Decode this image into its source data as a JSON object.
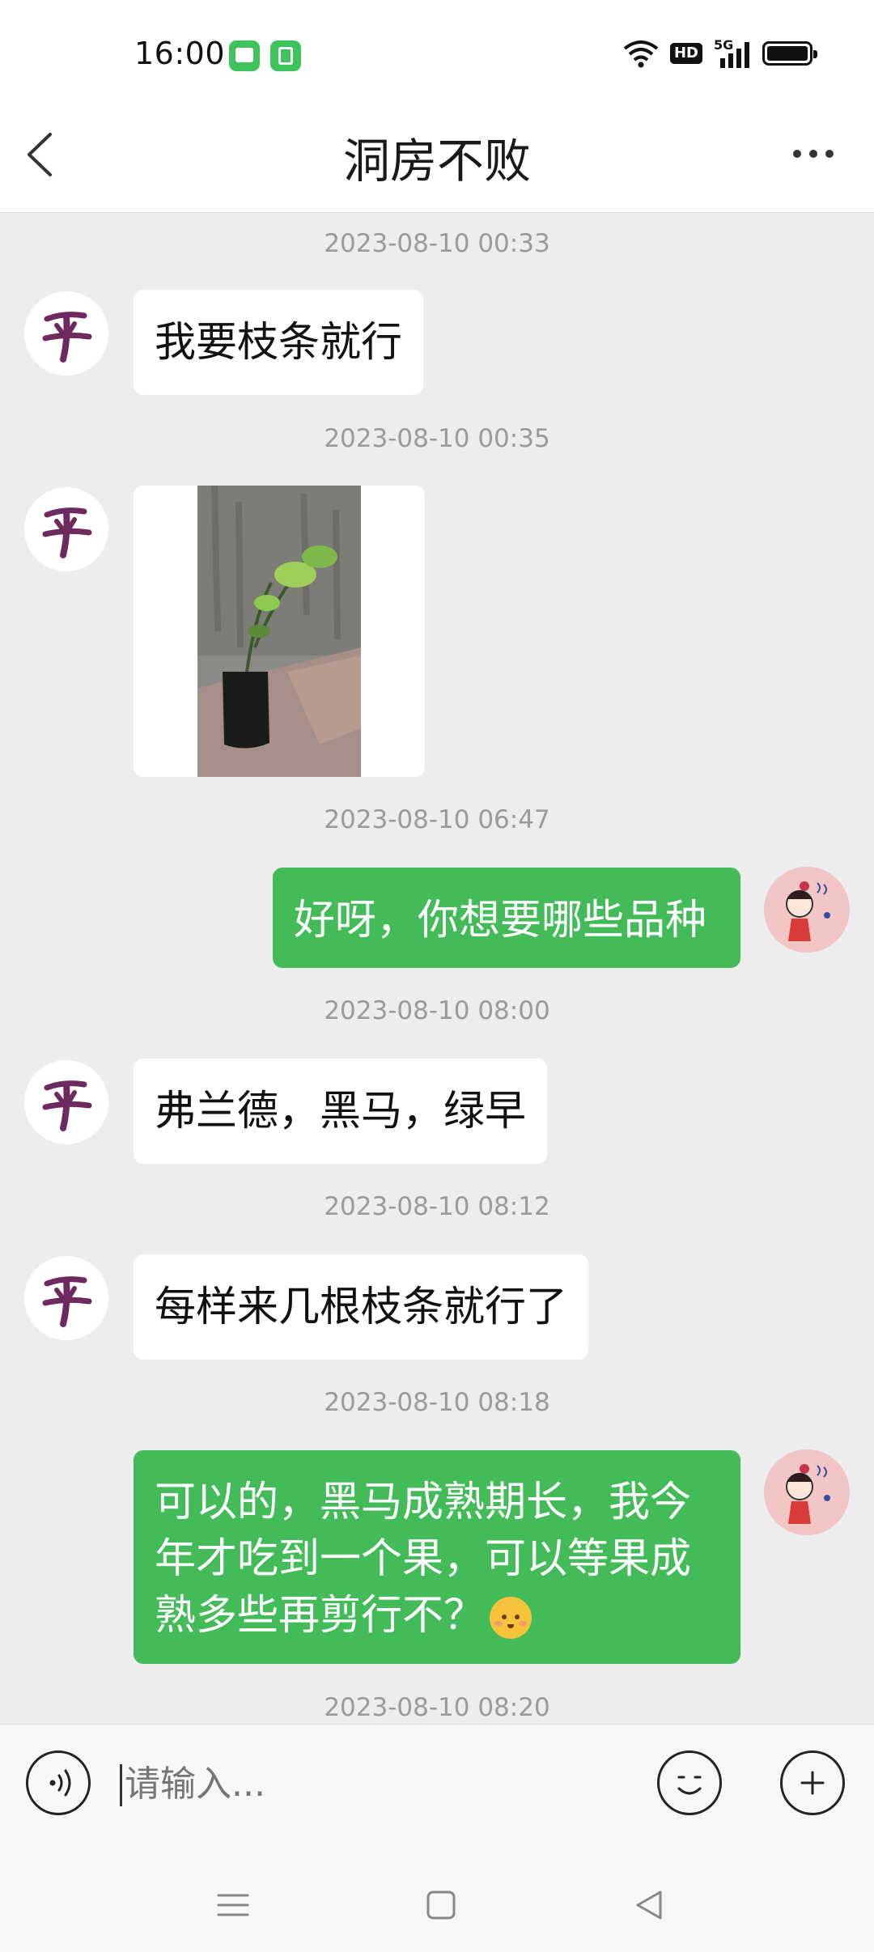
{
  "status_bar": {
    "time": "16:00",
    "notification_icons": [
      "message-app-icon",
      "store-app-icon"
    ],
    "indicators": {
      "wifi": "wifi-icon",
      "hd": "HD",
      "network": "5G",
      "battery": "battery-icon"
    }
  },
  "header": {
    "title": "洞房不败",
    "back_icon": "chevron-left-icon",
    "more_icon": "more-dots-icon"
  },
  "messages": [
    {
      "timestamp": "2023-08-10 00:33",
      "side": "in",
      "type": "text",
      "text": "我要枝条就行"
    },
    {
      "timestamp": "2023-08-10 00:35",
      "side": "in",
      "type": "image",
      "text": ""
    },
    {
      "timestamp": "2023-08-10 06:47",
      "side": "out",
      "type": "text",
      "text": "好呀，你想要哪些品种"
    },
    {
      "timestamp": "2023-08-10 08:00",
      "side": "in",
      "type": "text",
      "text": "弗兰德，黑马，绿早"
    },
    {
      "timestamp": "2023-08-10 08:12",
      "side": "in",
      "type": "text",
      "text": "每样来几根枝条就行了"
    },
    {
      "timestamp": "2023-08-10 08:18",
      "side": "out",
      "type": "text",
      "lines": [
        "可以的，黑马成熟期长，我今",
        "年才吃到一个果，可以等果成",
        "熟多些再剪行不？"
      ],
      "emoji": "blushing-face-emoji"
    },
    {
      "timestamp": "2023-08-10 08:20"
    }
  ],
  "input_bar": {
    "voice_icon": "voice-icon",
    "placeholder": "请输入...",
    "emoji_icon": "smiley-icon",
    "plus_icon": "plus-icon"
  },
  "nav_bar": {
    "menu_icon": "menu-icon",
    "home_icon": "home-square-icon",
    "back_icon": "back-triangle-icon"
  },
  "colors": {
    "outgoing_bubble": "#43bb58",
    "incoming_bubble": "#ffffff",
    "chat_background": "#ededed",
    "timestamp_text": "#9a9a9a"
  }
}
